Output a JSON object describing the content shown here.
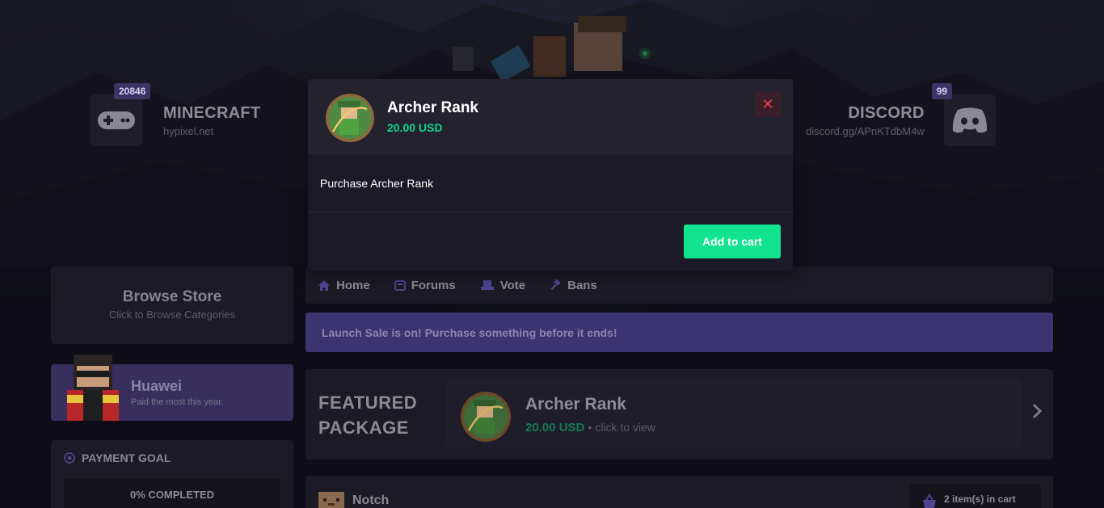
{
  "servers": {
    "minecraft": {
      "name": "MINECRAFT",
      "address": "hypixel.net",
      "count": "20846",
      "icon": "gamepad-icon"
    },
    "discord": {
      "name": "DISCORD",
      "address": "discord.gg/APnKTdbM4w",
      "count": "99",
      "icon": "discord-icon"
    }
  },
  "sidebar": {
    "browse_title": "Browse Store",
    "browse_sub": "Click to Browse Categories",
    "top_donor_name": "Huawei",
    "top_donor_sub": "Paid the most this year.",
    "goal_title": "PAYMENT GOAL",
    "goal_status": "0% COMPLETED",
    "goal_progress": 0
  },
  "nav": [
    {
      "label": "Home",
      "icon": "home-icon"
    },
    {
      "label": "Forums",
      "icon": "forums-icon"
    },
    {
      "label": "Vote",
      "icon": "vote-icon"
    },
    {
      "label": "Bans",
      "icon": "gavel-icon"
    }
  ],
  "sale_banner": "Launch Sale is on! Purchase something before it ends!",
  "featured": {
    "label_line1": "FEATURED",
    "label_line2": "PACKAGE",
    "name": "Archer Rank",
    "price": "20.00 USD",
    "click_text": "• click to view"
  },
  "bottom": {
    "username": "Notch",
    "cart_text": "2 item(s) in cart"
  },
  "modal": {
    "title": "Archer Rank",
    "price": "20.00 USD",
    "description": "Purchase Archer Rank",
    "close_label": "✕",
    "add_label": "Add to cart"
  },
  "colors": {
    "accent_purple": "#3b3471",
    "accent_green": "#12e38f",
    "close_red": "#ee3b4e"
  }
}
